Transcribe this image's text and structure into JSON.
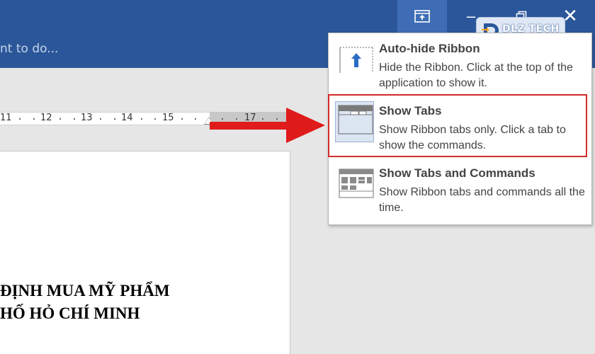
{
  "titlebar": {
    "ribbon_options_icon": "ribbon-display-options-icon",
    "minimize_icon": "minimize-icon",
    "restore_icon": "restore-icon",
    "close_icon": "close-icon",
    "minimize_glyph": "–",
    "close_glyph": "✕"
  },
  "tellme": {
    "text": "nt to do..."
  },
  "logo": {
    "text": "DLZ TECH"
  },
  "ruler": {
    "labels": [
      "11",
      "12",
      "13",
      "14",
      "15",
      "17"
    ]
  },
  "document": {
    "lines": [
      "ĐỊNH MUA MỸ PHẨM",
      "HỐ HỎ CHÍ MINH"
    ]
  },
  "menu": {
    "items": [
      {
        "title": "Auto-hide Ribbon",
        "desc": "Hide the Ribbon. Click at the top of the application to show it.",
        "icon": "auto-hide-ribbon-icon"
      },
      {
        "title": "Show Tabs",
        "desc": "Show Ribbon tabs only. Click a tab to show the commands.",
        "icon": "show-tabs-icon"
      },
      {
        "title": "Show Tabs and Commands",
        "desc": "Show Ribbon tabs and commands all the time.",
        "icon": "show-tabs-commands-icon"
      }
    ]
  },
  "colors": {
    "titlebar": "#2b579a",
    "highlight": "#d42a2a",
    "arrow": "#e01b1b"
  }
}
